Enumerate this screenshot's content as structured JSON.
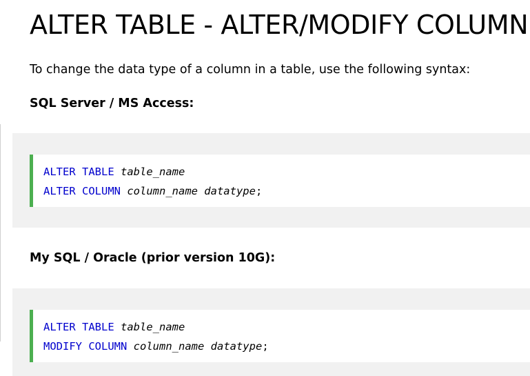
{
  "title": "ALTER TABLE - ALTER/MODIFY COLUMN",
  "intro": "To change the data type of a column in a table, use the following syntax:",
  "sections": [
    {
      "heading": "SQL Server / MS Access:",
      "lines": [
        {
          "keyword": "ALTER TABLE",
          "args": "table_name",
          "end": ""
        },
        {
          "keyword": "ALTER COLUMN",
          "args": "column_name datatype",
          "end": ";"
        }
      ]
    },
    {
      "heading": "My SQL / Oracle (prior version 10G):",
      "lines": [
        {
          "keyword": "ALTER TABLE",
          "args": "table_name",
          "end": ""
        },
        {
          "keyword": "MODIFY COLUMN",
          "args": "column_name datatype",
          "end": ";"
        }
      ]
    }
  ],
  "colors": {
    "keyword": "#0000cd",
    "accent_border": "#4caf50",
    "panel_background": "#f1f1f1"
  }
}
